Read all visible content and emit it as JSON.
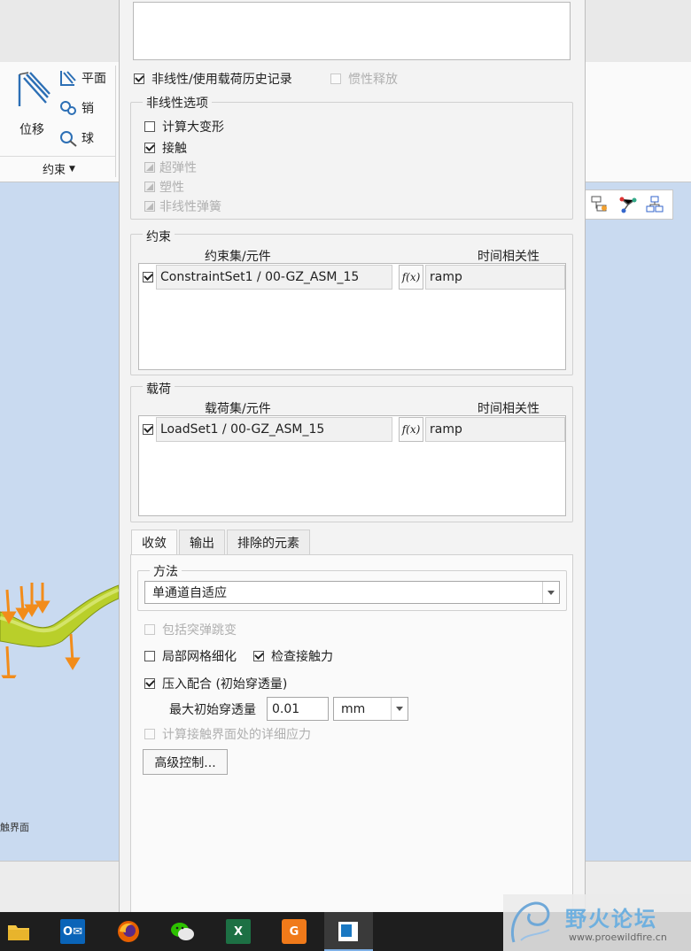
{
  "ribbon": {
    "displacement_label": "位移",
    "plane_label": "平面",
    "pin_label": "销",
    "ball_label": "球",
    "group_label": "约束"
  },
  "viewport": {
    "contact_label_partial": "触界面"
  },
  "dialog": {
    "nonlinear_history": {
      "label": "非线性/使用载荷历史记录",
      "checked": true
    },
    "inertia_relief": {
      "label": "惯性释放",
      "checked": false,
      "enabled": false
    },
    "nonlinear_options": {
      "title": "非线性选项",
      "large_deformation": "计算大变形",
      "contact": "接触",
      "hyperelastic": "超弹性",
      "plasticity": "塑性",
      "nonlinear_spring": "非线性弹簧"
    },
    "constraints": {
      "title": "约束",
      "col_set": "约束集/元件",
      "col_time": "时间相关性",
      "rows": [
        {
          "name": "ConstraintSet1 / 00-GZ_ASM_15",
          "fx": "f(x)",
          "time": "ramp"
        }
      ]
    },
    "loads": {
      "title": "载荷",
      "col_set": "载荷集/元件",
      "col_time": "时间相关性",
      "rows": [
        {
          "name": "LoadSet1 / 00-GZ_ASM_15",
          "fx": "f(x)",
          "time": "ramp"
        }
      ]
    },
    "tabs": [
      "收敛",
      "输出",
      "排除的元素"
    ],
    "convergence": {
      "method_title": "方法",
      "method_value": "单通道自适应",
      "include_snap": "包括突弹跳变",
      "local_mesh": "局部网格细化",
      "check_contact": "检查接触力",
      "press_fit": "压入配合 (初始穿透量)",
      "max_penetration_label": "最大初始穿透量",
      "max_penetration_value": "0.01",
      "unit": "mm",
      "detailed_stress": "计算接触界面处的详细应力",
      "advanced_button": "高级控制..."
    }
  },
  "watermark": {
    "site_name": "野火论坛",
    "url": "www.proewildfire.cn"
  },
  "colors": {
    "viewport": "#c9daf0",
    "taskbar": "#1e1e1e",
    "model_green": "#b9cf2a",
    "load_arrow": "#f28c1a"
  }
}
